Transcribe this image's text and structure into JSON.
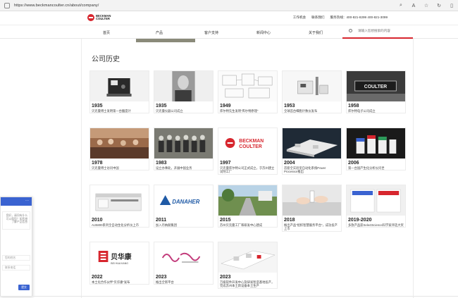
{
  "browser": {
    "url": "https://www.beckmancoulter.cn/about/company/",
    "icons": [
      "search-icon",
      "read-aloud-icon",
      "favorite-icon",
      "refresh-icon",
      "reader-icon"
    ]
  },
  "header": {
    "logo_line1": "BECKMAN",
    "logo_line2": "COULTER",
    "top_links": [
      "工作机会",
      "联系我们",
      "服务热线：400-821-8299 400-821-3099"
    ]
  },
  "nav": {
    "items": [
      "首页",
      "产品",
      "客户支持",
      "新闻中心",
      "关于我们"
    ],
    "search_placeholder": "请输入您想搜索的内容"
  },
  "section": {
    "title": "公司历史"
  },
  "cards": [
    {
      "year": "1935",
      "desc": "贝克曼博士发明第一台酸度计",
      "img": "device-dark"
    },
    {
      "year": "1935",
      "desc": "贝克曼仪器公司成立",
      "img": "portrait"
    },
    {
      "year": "1949",
      "desc": "库尔特先生发明“库尔特原理”",
      "img": "patent-drawing"
    },
    {
      "year": "1953",
      "desc": "全球首台细胞计数仪发布",
      "img": "instrument-white"
    },
    {
      "year": "1958",
      "desc": "库尔特电子公司成立",
      "img": "coulter-sign"
    },
    {
      "year": "1978",
      "desc": "贝克曼博士访问中国",
      "img": "group-photo"
    },
    {
      "year": "1983",
      "desc": "设立办事处，开展中国业务",
      "img": "group-photo-2"
    },
    {
      "year": "1997",
      "desc": "贝克曼库尔特公司正式成立，于苏州建立试剂工厂",
      "img": "logo-red"
    },
    {
      "year": "2004",
      "desc": "首套全实验室自动化系统Power Processor推出",
      "img": "automation-line"
    },
    {
      "year": "2006",
      "desc": "第一台国产生化分析仪问世",
      "img": "reagent-kits"
    },
    {
      "year": "2010",
      "desc": "AU5800系列全自动生化分析仪上市",
      "img": "analyzer-white"
    },
    {
      "year": "2011",
      "desc": "加入丹纳赫集团",
      "img": "danaher-logo"
    },
    {
      "year": "2015",
      "desc": "苏州贝克曼工厂和研发中心建成",
      "img": "campus-road"
    },
    {
      "year": "2018",
      "desc": "推出产品“组织智慧服务平台”，成功投产上市",
      "img": "lab-hands"
    },
    {
      "year": "2019-2020",
      "desc": "多款产品获SelectScience科学家评选大奖",
      "img": "brochure"
    },
    {
      "year": "2022",
      "desc": "本土化合作伙伴“贝华康”发布",
      "img": "beihuakang-logo"
    },
    {
      "year": "2023",
      "desc": "推出全新平台",
      "img": "calligraphy"
    },
    {
      "year": "2023",
      "desc": "万级软件开发中心及研发智造基地投产，完成苏州本土新设备本土生产",
      "img": "lab-line"
    }
  ],
  "logos": {
    "coulter_sign": "COULTER",
    "beckman_line1": "BECKMAN",
    "beckman_line2": "COULTER",
    "danaher": "DANAHER",
    "beihuakang_cn": "贝华康",
    "beihuakang_en": "BEI HUA KANG"
  },
  "chat": {
    "dots": "···",
    "bubble_text": "您好，请问有什么可以帮您？如您想了解产品信息",
    "field1": "您的姓名",
    "field2": "联系电话",
    "send_label": "提交"
  },
  "colors": {
    "brand_red": "#d7262e",
    "chat_blue": "#3a63d1"
  }
}
